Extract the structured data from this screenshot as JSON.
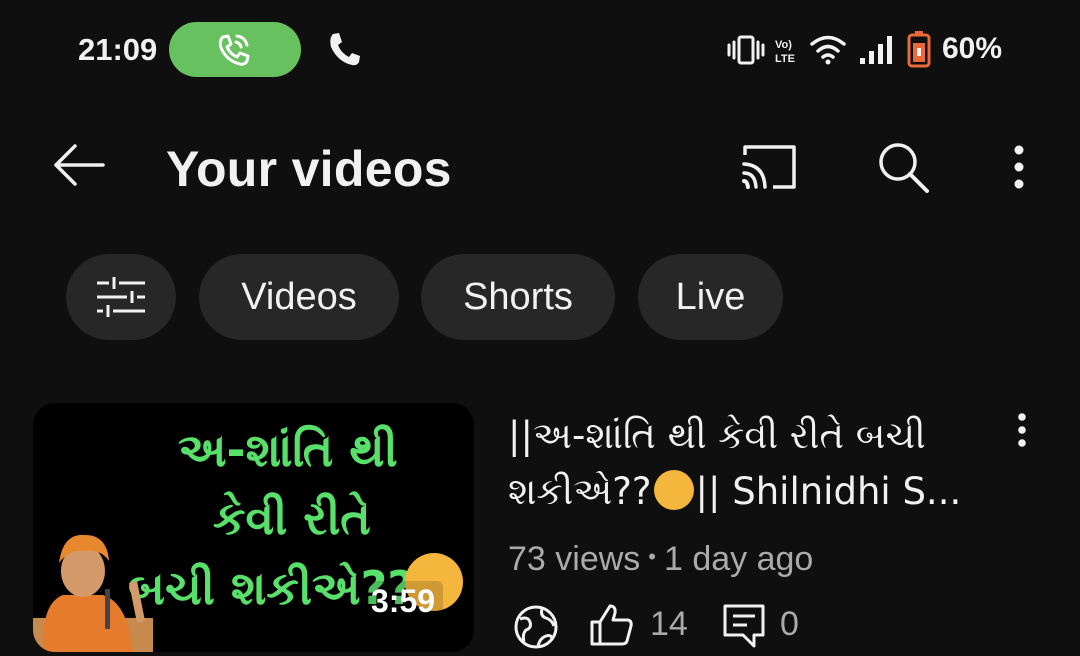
{
  "status_bar": {
    "time": "21:09",
    "battery_percent": "60%",
    "icons": [
      "phone-call-icon",
      "phone-icon",
      "vibrate-icon",
      "volte-icon",
      "wifi-icon",
      "signal-icon",
      "battery-icon"
    ],
    "call_pill_color": "#67c15e",
    "battery_color": "#e86a3a"
  },
  "app_bar": {
    "title": "Your videos",
    "icons": [
      "back-arrow-icon",
      "cast-icon",
      "search-icon",
      "more-vert-icon"
    ]
  },
  "chips": {
    "filter_icon": "filter-sliders-icon",
    "videos": "Videos",
    "shorts": "Shorts",
    "live": "Live"
  },
  "video": {
    "thumbnail": {
      "line1": "અ-શાંતિ થી",
      "line2": "કેવી રીતે",
      "line3": "બચી શકીએ??",
      "text_color": "#58e06a",
      "duration": "3:59"
    },
    "title_line1": "||અ-શાંતિ થી કેવી રીતે બચી",
    "title_line2_pre": "શકીએ??",
    "title_line2_post": "|| Shilnidhi S...",
    "views": "73 views",
    "separator": "•",
    "age": "1 day ago",
    "visibility_icon": "globe-icon",
    "likes": "14",
    "comments": "0"
  }
}
